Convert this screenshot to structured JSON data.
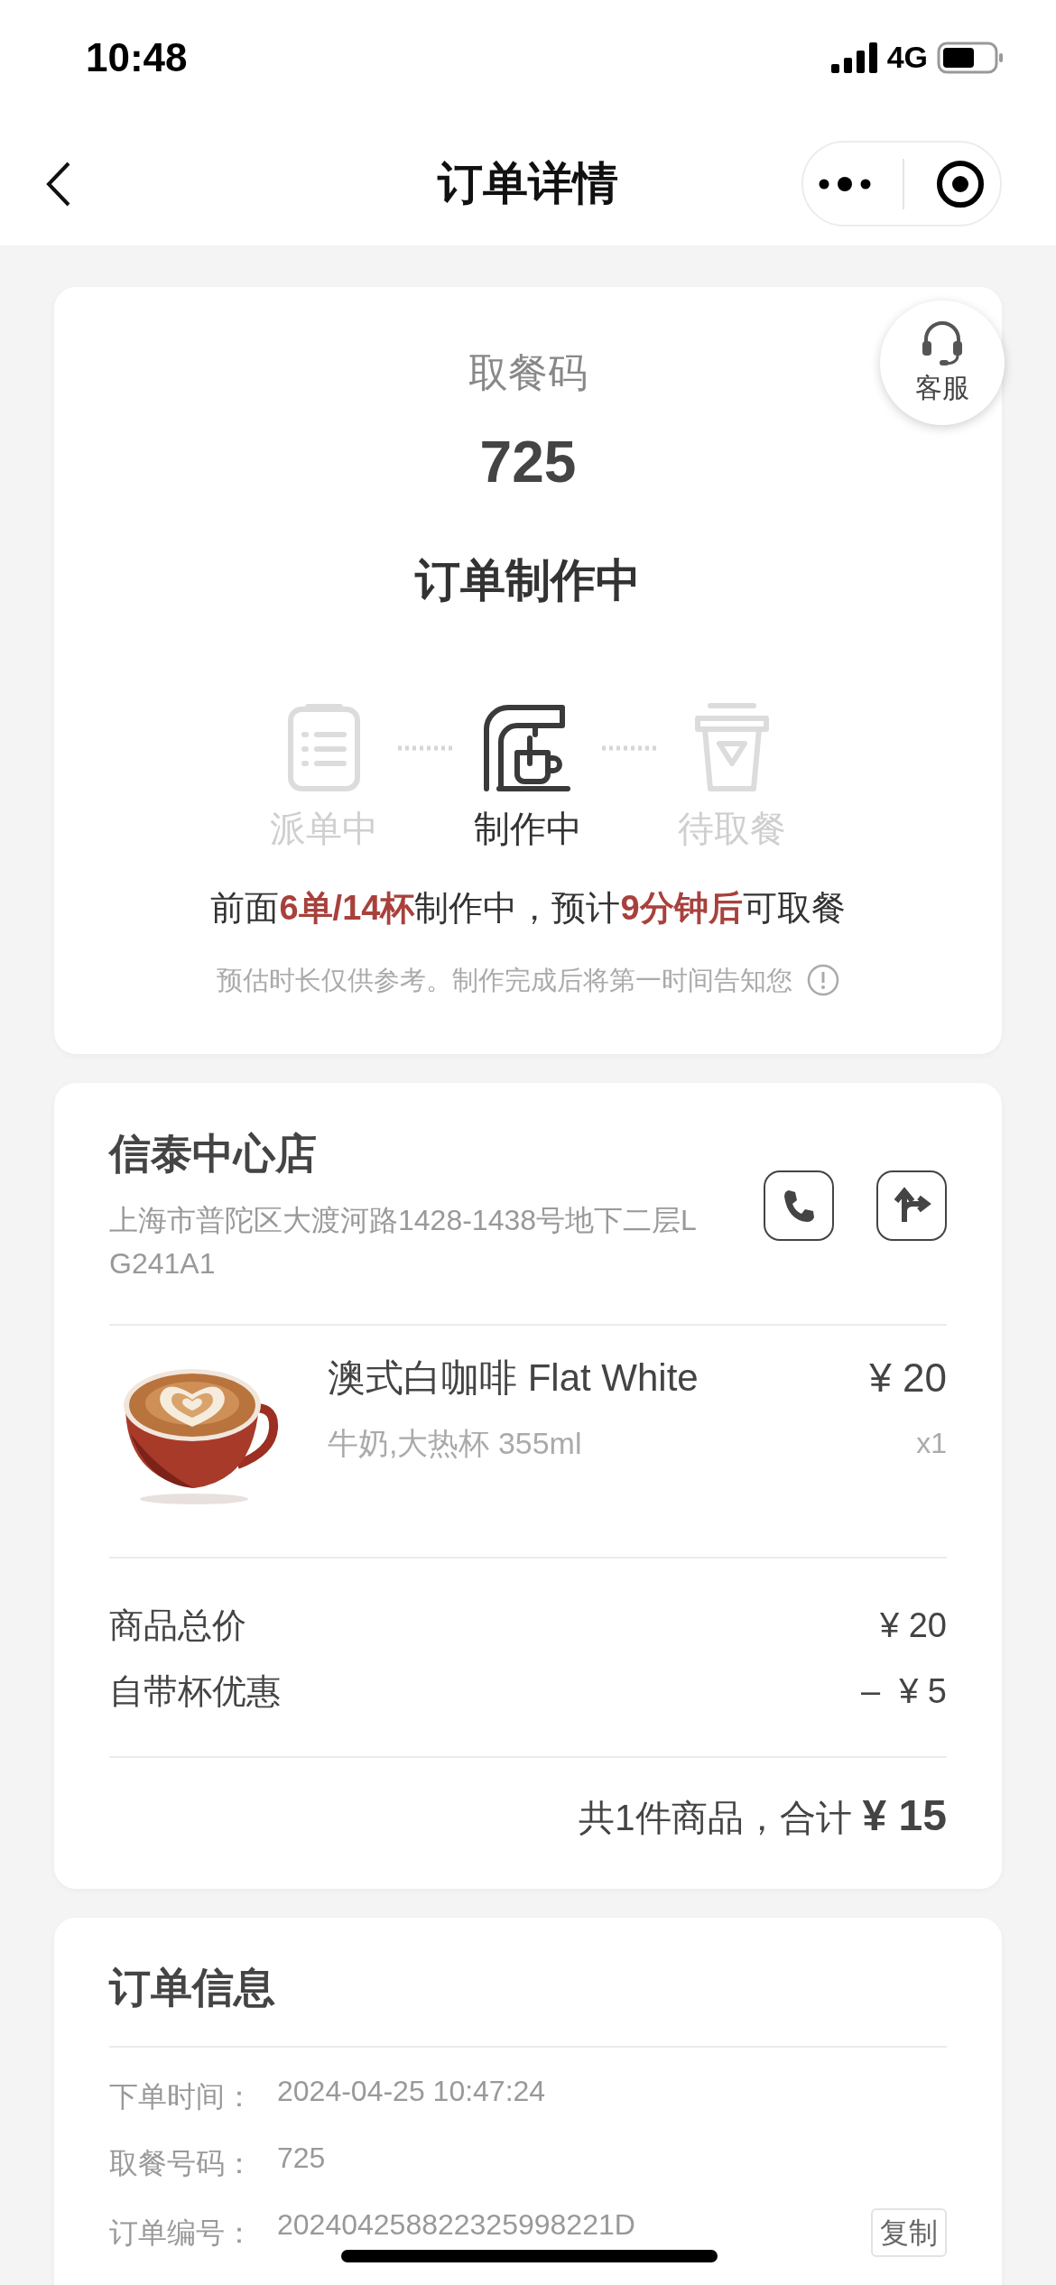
{
  "status_bar": {
    "time": "10:48",
    "network": "4G"
  },
  "nav": {
    "title": "订单详情"
  },
  "pickup": {
    "label": "取餐码",
    "code": "725",
    "status": "订单制作中",
    "support": "客服",
    "steps": [
      {
        "label": "派单中",
        "kind": "dispatch",
        "selected": false
      },
      {
        "label": "制作中",
        "kind": "making",
        "selected": true
      },
      {
        "label": "待取餐",
        "kind": "pickup",
        "selected": false
      }
    ],
    "queue_message": "前面**6单/14杯**制作中，预计**9分钟后**可取餐",
    "note": "预估时长仅供参考。制作完成后将第一时间告知您"
  },
  "store": {
    "name": "信泰中心店",
    "address": "上海市普陀区大渡河路1428-1438号地下二层LG241A1"
  },
  "items": [
    {
      "kind": "picture",
      "name": "澳式白咖啡 Flat White",
      "spec": "牛奶,大热杯 355ml",
      "price": "¥ 20",
      "quantity": "x1"
    }
  ],
  "fees": [
    {
      "label": "商品总价",
      "amount": "¥ 20"
    },
    {
      "label": "自带杯优惠",
      "amount": "–  ¥ 5"
    }
  ],
  "total": {
    "summary": "共1件商品，合计",
    "amount": "¥ 15"
  },
  "order_info": {
    "title": "订单信息",
    "rows": [
      {
        "label": "下单时间：",
        "value": "2024-04-25 10:47:24"
      },
      {
        "label": "取餐号码：",
        "value": "725"
      },
      {
        "label": "订单编号：",
        "value": "202404258822325998221D",
        "action": "复制"
      }
    ]
  }
}
